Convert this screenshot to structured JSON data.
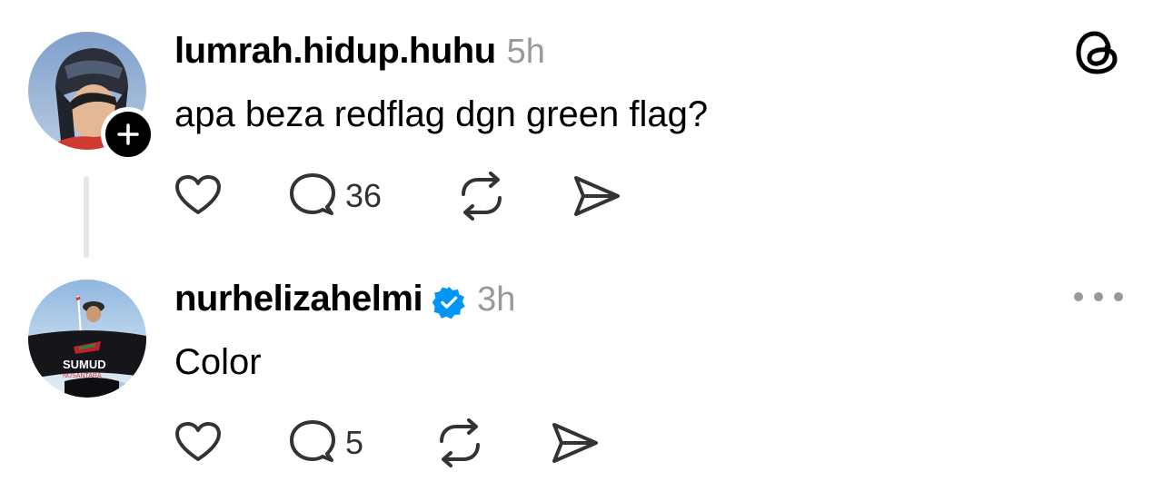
{
  "colors": {
    "text_primary": "#000000",
    "text_secondary": "#999999",
    "verified_badge": "#0095F6",
    "thread_line": "#E6E6E6"
  },
  "app": {
    "logo_icon": "threads-logo-icon"
  },
  "posts": [
    {
      "username": "lumrah.hidup.huhu",
      "timestamp": "5h",
      "text": "apa beza redflag dgn green flag?",
      "verified": false,
      "follow_badge_icon": "plus-icon",
      "comments_count": "36"
    },
    {
      "username": "nurhelizahelmi",
      "timestamp": "3h",
      "text": "Color",
      "verified": true,
      "verified_icon": "verified-badge-icon",
      "more_icon": "more-horizontal-icon",
      "comments_count": "5"
    }
  ]
}
